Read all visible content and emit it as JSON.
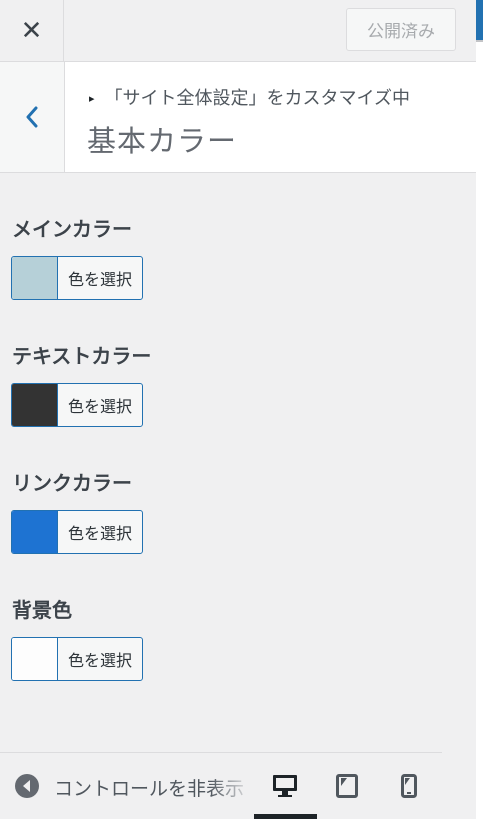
{
  "header": {
    "close_label": "✕",
    "publish_label": "公開済み"
  },
  "section": {
    "breadcrumb_marker": "▸",
    "breadcrumb": "「サイト全体設定」をカスタマイズ中",
    "title": "基本カラー"
  },
  "controls": [
    {
      "label": "メインカラー",
      "button_label": "色を選択",
      "color": "#b6d0d8"
    },
    {
      "label": "テキストカラー",
      "button_label": "色を選択",
      "color": "#333333"
    },
    {
      "label": "リンクカラー",
      "button_label": "色を選択",
      "color": "#1e73d2"
    },
    {
      "label": "背景色",
      "button_label": "色を選択",
      "color": "#fdfdfd"
    }
  ],
  "footer": {
    "collapse_label": "コントロールを非表示",
    "devices": [
      "desktop",
      "tablet",
      "mobile"
    ],
    "active_device": "desktop"
  },
  "colors": {
    "accent": "#2271b1",
    "background": "#f0f0f1"
  }
}
